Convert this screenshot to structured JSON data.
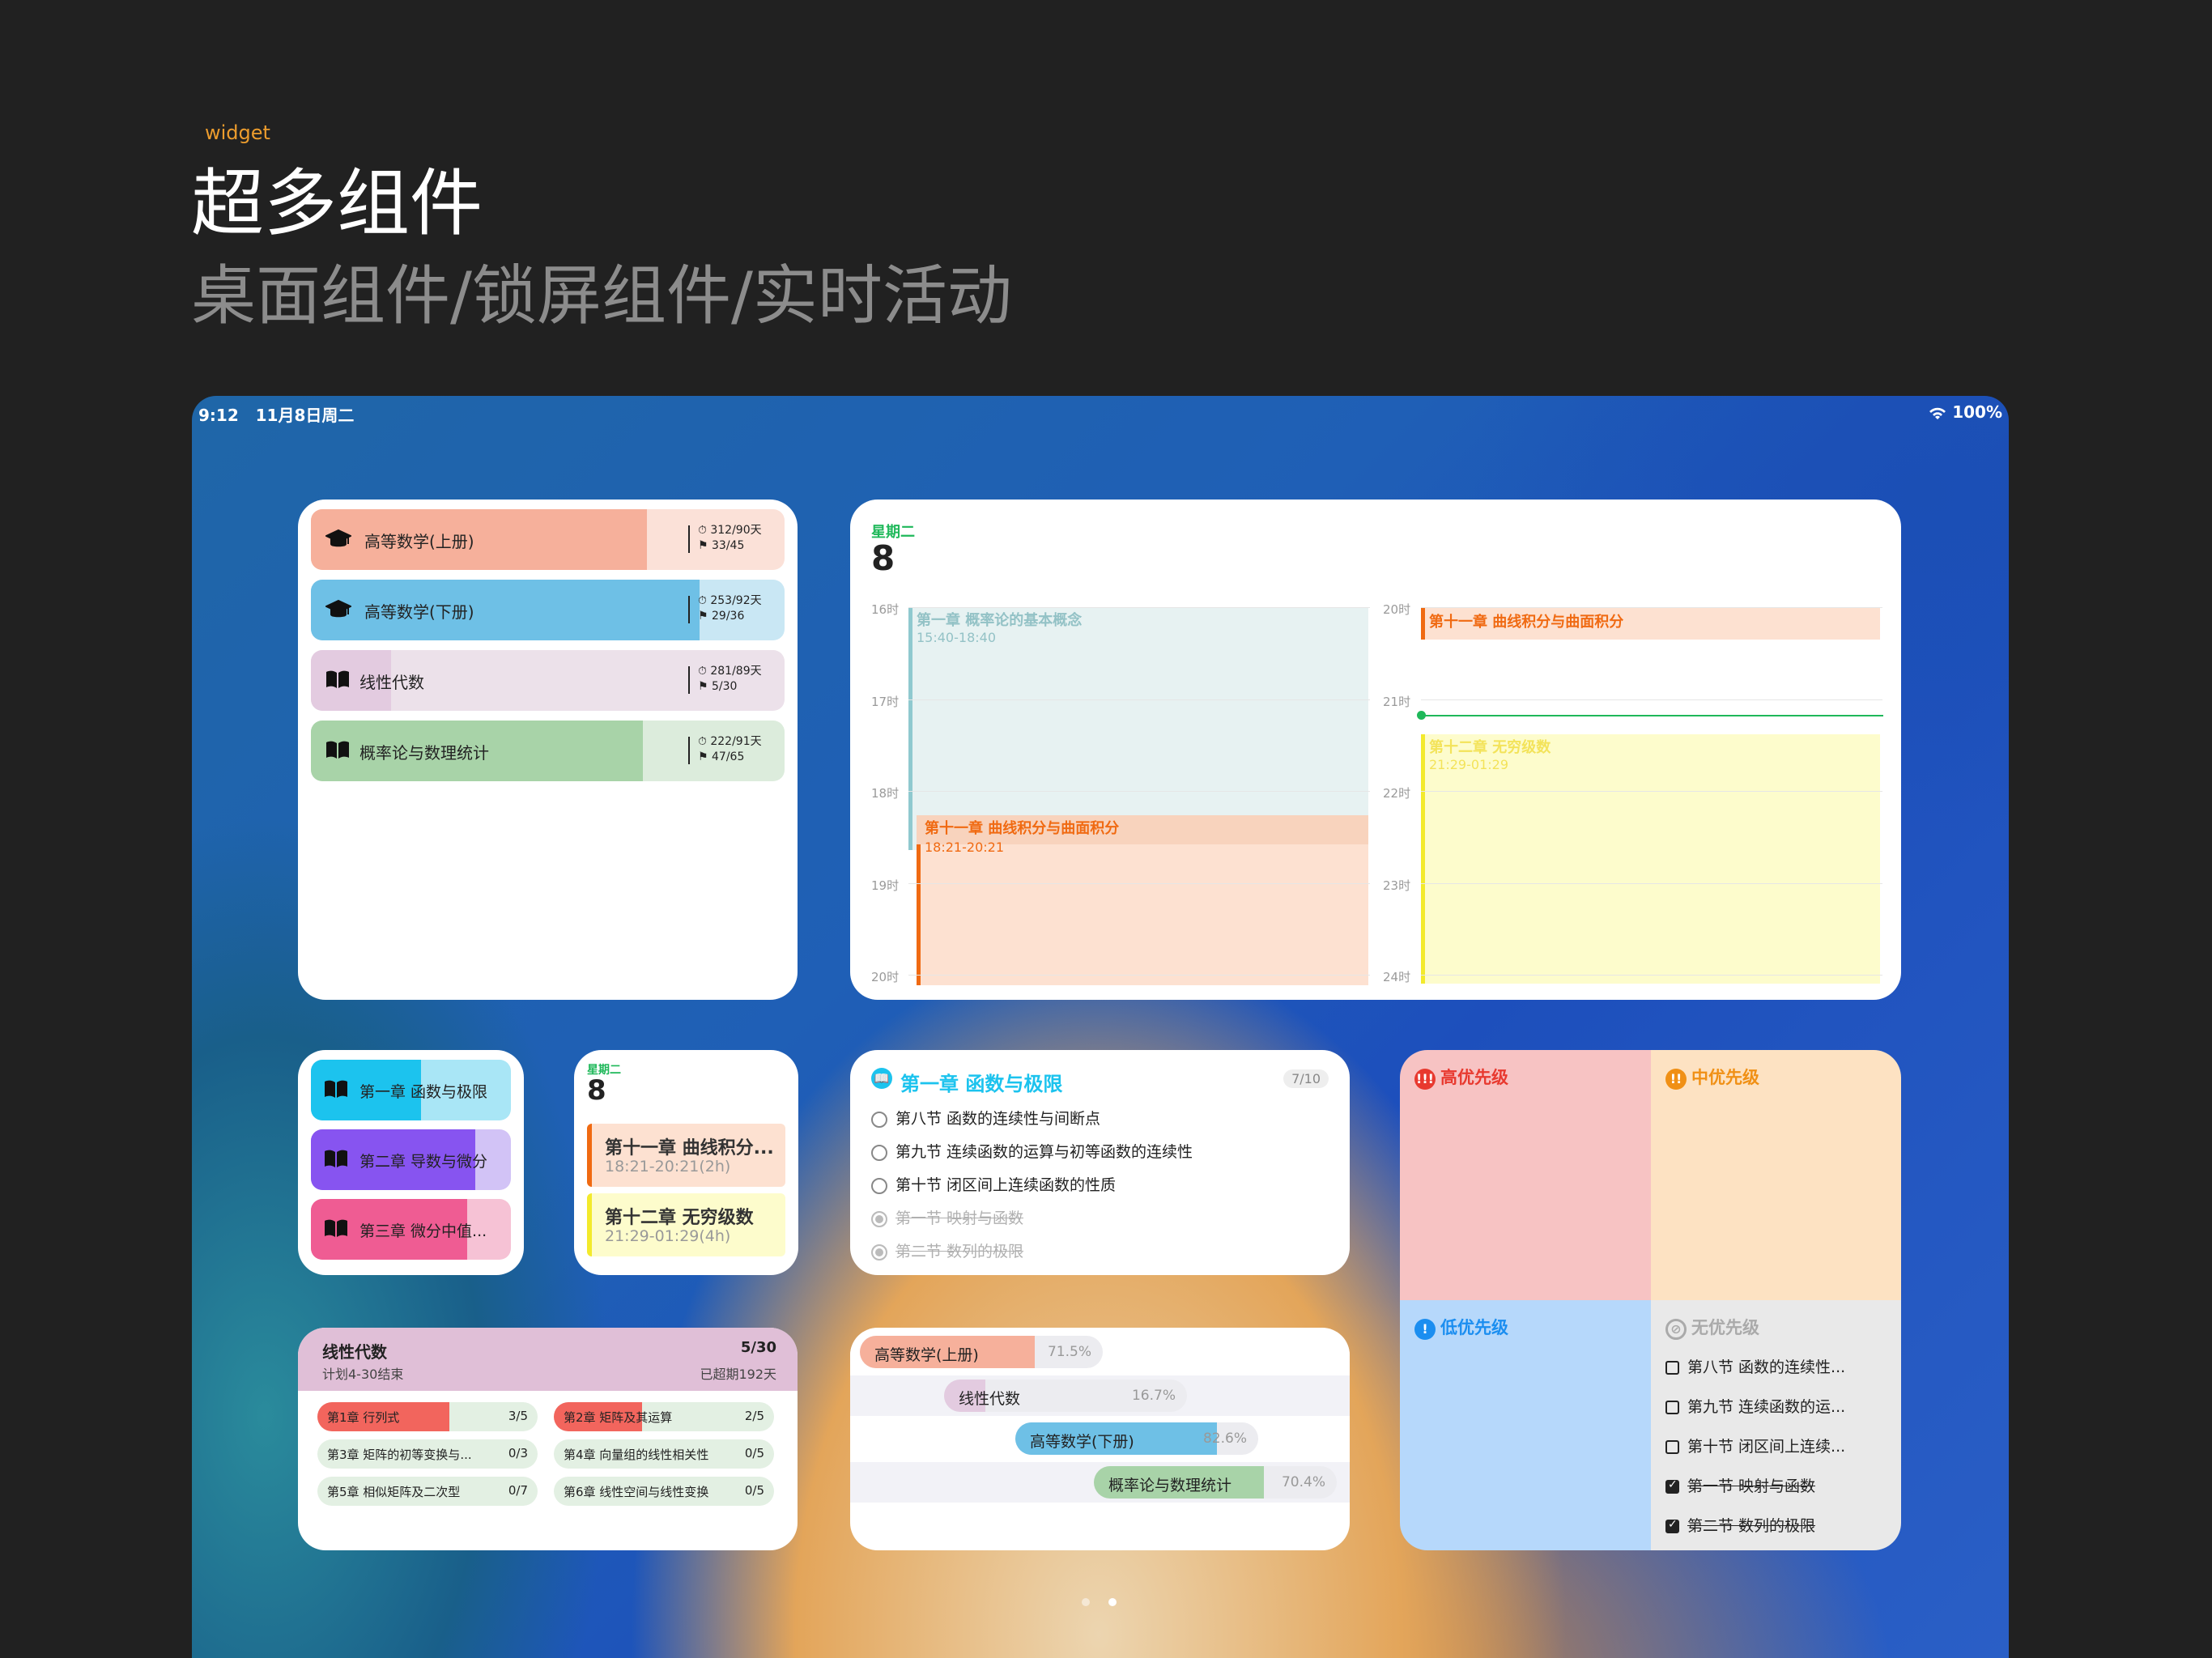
{
  "header": {
    "tag": "widget",
    "title": "超多组件",
    "subtitle": "桌面组件/锁屏组件/实时活动"
  },
  "status": {
    "time": "9:12",
    "date": "11月8日周二",
    "battery": "100%"
  },
  "courses": [
    {
      "name": "高等数学(上册)",
      "days": "312/90天",
      "tasks": "33/45",
      "icon": "graduation-cap-icon",
      "color": "#f6b09b",
      "bg": "#fbe1d8",
      "progress": 0.71
    },
    {
      "name": "高等数学(下册)",
      "days": "253/92天",
      "tasks": "29/36",
      "icon": "graduation-cap-icon",
      "color": "#6ec0e6",
      "bg": "#c9e7f4",
      "progress": 0.82
    },
    {
      "name": "线性代数",
      "days": "281/89天",
      "tasks": "5/30",
      "icon": "book-icon",
      "color": "#e3cbe0",
      "bg": "#ece1ea",
      "progress": 0.17
    },
    {
      "name": "概率论与数理统计",
      "days": "222/91天",
      "tasks": "47/65",
      "icon": "book-icon",
      "color": "#a8d3a8",
      "bg": "#dcecdc",
      "progress": 0.7
    }
  ],
  "calendar": {
    "weekday": "星期二",
    "day": "8",
    "left_hours": [
      "16时",
      "17时",
      "18时",
      "19时",
      "20时"
    ],
    "right_hours": [
      "20时",
      "21时",
      "22时",
      "23时",
      "24时"
    ],
    "events": [
      {
        "title": "第一章 概率论的基本概念",
        "time": "15:40-18:40"
      },
      {
        "title": "第十一章 曲线积分与曲面积分",
        "time": "18:21-20:21"
      },
      {
        "title": "第十一章 曲线积分与曲面积分",
        "time": ""
      },
      {
        "title": "第十二章 无穷级数",
        "time": "21:29-01:29"
      }
    ]
  },
  "chapters": [
    {
      "name": "第一章 函数与极限",
      "color": "#1cc3ee",
      "bg": "#a9e6f6",
      "progress": 0.55
    },
    {
      "name": "第二章 导数与微分",
      "color": "#8754f0",
      "bg": "#d2c3f6",
      "progress": 0.82
    },
    {
      "name": "第三章 微分中值...",
      "color": "#ef5c93",
      "bg": "#f6c2d5",
      "progress": 0.78
    }
  ],
  "small_cal": {
    "weekday": "星期二",
    "day": "8",
    "events": [
      {
        "title": "第十一章 曲线积分...",
        "time": "18:21-20:21(2h)"
      },
      {
        "title": "第十二章 无穷级数",
        "time": "21:29-01:29(4h)"
      }
    ]
  },
  "checklist": {
    "title": "第一章 函数与极限",
    "count": "7/10",
    "items": [
      {
        "text": "第八节 函数的连续性与间断点",
        "done": false
      },
      {
        "text": "第九节 连续函数的运算与初等函数的连续性",
        "done": false
      },
      {
        "text": "第十节 闭区间上连续函数的性质",
        "done": false
      },
      {
        "text": "第一节 映射与函数",
        "done": true
      },
      {
        "text": "第二节 数列的极限",
        "done": true
      }
    ]
  },
  "priority": {
    "high": "高优先级",
    "mid": "中优先级",
    "low": "低优先级",
    "none": "无优先级",
    "items": [
      {
        "text": "第八节 函数的连续性...",
        "done": false
      },
      {
        "text": "第九节 连续函数的运...",
        "done": false
      },
      {
        "text": "第十节 闭区间上连续...",
        "done": false
      },
      {
        "text": "第一节 映射与函数",
        "done": true
      },
      {
        "text": "第二节 数列的极限",
        "done": true
      }
    ]
  },
  "plan": {
    "title": "线性代数",
    "count": "5/30",
    "sub": "计划4-30结束",
    "overdue": "已超期192天",
    "items": [
      {
        "text": "第1章 行列式",
        "count": "3/5",
        "progress": 0.6
      },
      {
        "text": "第2章 矩阵及其运算",
        "count": "2/5",
        "progress": 0.4
      },
      {
        "text": "第3章 矩阵的初等变换与...",
        "count": "0/3",
        "progress": 0
      },
      {
        "text": "第4章 向量组的线性相关性",
        "count": "0/5",
        "progress": 0
      },
      {
        "text": "第5章 相似矩阵及二次型",
        "count": "0/7",
        "progress": 0
      },
      {
        "text": "第6章 线性空间与线性变换",
        "count": "0/5",
        "progress": 0
      }
    ]
  },
  "gantt": [
    {
      "name": "高等数学(上册)",
      "pct": "71.5%",
      "progress": 0.715
    },
    {
      "name": "线性代数",
      "pct": "16.7%",
      "progress": 0.167
    },
    {
      "name": "高等数学(下册)",
      "pct": "82.6%",
      "progress": 0.826
    },
    {
      "name": "概率论与数理统计",
      "pct": "70.4%",
      "progress": 0.704
    }
  ],
  "colors": {
    "accent_green": "#1fb85a",
    "high": "#f7c3c3",
    "mid": "#fde2c2",
    "low": "#b6d8fb",
    "none": "#e9e9e9",
    "blue": "#1b8ef0",
    "orange": "#f09015",
    "red": "#e8392f"
  }
}
